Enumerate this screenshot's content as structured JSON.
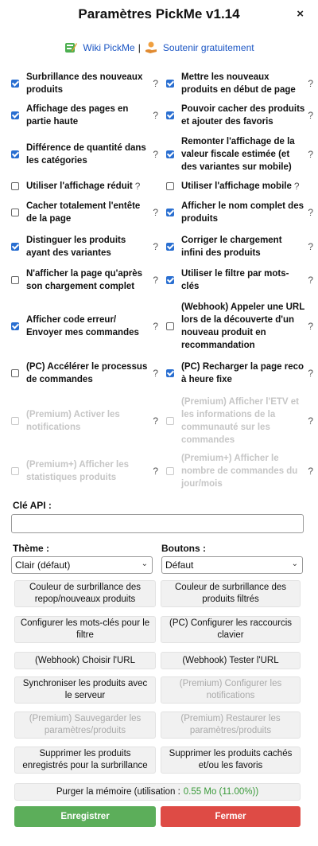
{
  "header": {
    "title": "Paramètres PickMe v1.14",
    "close_label": "×"
  },
  "links": {
    "wiki": "Wiki PickMe",
    "separator": "|",
    "support": "Soutenir gratuitement"
  },
  "options": [
    {
      "left": {
        "label": "Surbrillance des nouveaux produits",
        "checked": true
      },
      "right": {
        "label": "Mettre les nouveaux produits en début de page",
        "checked": true
      }
    },
    {
      "left": {
        "label": "Affichage des pages en partie haute",
        "checked": true
      },
      "right": {
        "label": "Pouvoir cacher des produits et ajouter des favoris",
        "checked": true
      }
    },
    {
      "left": {
        "label": "Différence de quantité dans les catégories",
        "checked": true
      },
      "right": {
        "label": "Remonter l'affichage de la valeur fiscale estimée (et des variantes sur mobile)",
        "checked": true
      }
    },
    {
      "left": {
        "label": "Utiliser l'affichage réduit",
        "checked": false
      },
      "right": {
        "label": "Utiliser l'affichage mobile",
        "checked": false
      }
    },
    {
      "left": {
        "label": "Cacher totalement l'entête de la page",
        "checked": false
      },
      "right": {
        "label": "Afficher le nom complet des produits",
        "checked": true
      }
    },
    {
      "left": {
        "label": "Distinguer les produits ayant des variantes",
        "checked": true
      },
      "right": {
        "label": "Corriger le chargement infini des produits",
        "checked": true
      }
    },
    {
      "left": {
        "label": "N'afficher la page qu'après son chargement complet",
        "checked": false
      },
      "right": {
        "label": "Utiliser le filtre par mots-clés",
        "checked": true
      }
    },
    {
      "left": {
        "label": "Afficher code erreur/ Envoyer mes commandes",
        "checked": true
      },
      "right": {
        "label": "(Webhook) Appeler une URL lors de la découverte d'un nouveau produit en recommandation",
        "checked": false
      }
    },
    {
      "left": {
        "label": "(PC) Accélérer le processus de commandes",
        "checked": false
      },
      "right": {
        "label": "(PC) Recharger la page reco à heure fixe",
        "checked": true
      }
    },
    {
      "left": {
        "label": "(Premium) Activer les notifications",
        "checked": false,
        "disabled": true
      },
      "right": {
        "label": "(Premium) Afficher l'ETV et les informations de la communauté sur les commandes",
        "checked": false,
        "disabled": true
      }
    },
    {
      "left": {
        "label": "(Premium+) Afficher les statistiques produits",
        "checked": false,
        "disabled": true
      },
      "right": {
        "label": "(Premium+) Afficher le nombre de commandes du jour/mois",
        "checked": false,
        "disabled": true
      }
    }
  ],
  "help_mark": "?",
  "api": {
    "label": "Clé API :",
    "value": "",
    "placeholder": ""
  },
  "theme": {
    "label": "Thème :",
    "selected": "Clair (défaut)"
  },
  "buttons_style": {
    "label": "Boutons :",
    "selected": "Défaut"
  },
  "actions": [
    {
      "label": "Couleur de surbrillance des repop/nouveaux produits",
      "disabled": false
    },
    {
      "label": "Couleur de surbrillance des produits filtrés",
      "disabled": false
    },
    {
      "label": "Configurer les mots-clés pour le filtre",
      "disabled": false
    },
    {
      "label": "(PC) Configurer les raccourcis clavier",
      "disabled": false
    },
    {
      "label": "(Webhook) Choisir l'URL",
      "disabled": false
    },
    {
      "label": "(Webhook) Tester l'URL",
      "disabled": false
    },
    {
      "label": "Synchroniser les produits avec le serveur",
      "disabled": false
    },
    {
      "label": "(Premium) Configurer les notifications",
      "disabled": true
    },
    {
      "label": "(Premium) Sauvegarder les paramètres/produits",
      "disabled": true
    },
    {
      "label": "(Premium) Restaurer les paramètres/produits",
      "disabled": true
    },
    {
      "label": "Supprimer les produits enregistrés pour la surbrillance",
      "disabled": false
    },
    {
      "label": "Supprimer les produits cachés et/ou les favoris",
      "disabled": false
    }
  ],
  "purge": {
    "label": "Purger la mémoire (utilisation :",
    "value": "0.55 Mo (11.00%))"
  },
  "footer": {
    "save": "Enregistrer",
    "cancel": "Fermer"
  },
  "colors": {
    "accent": "#2a6fd1",
    "save": "#5cae5a",
    "cancel": "#de4b45",
    "memory_value": "#3a9a3a"
  }
}
